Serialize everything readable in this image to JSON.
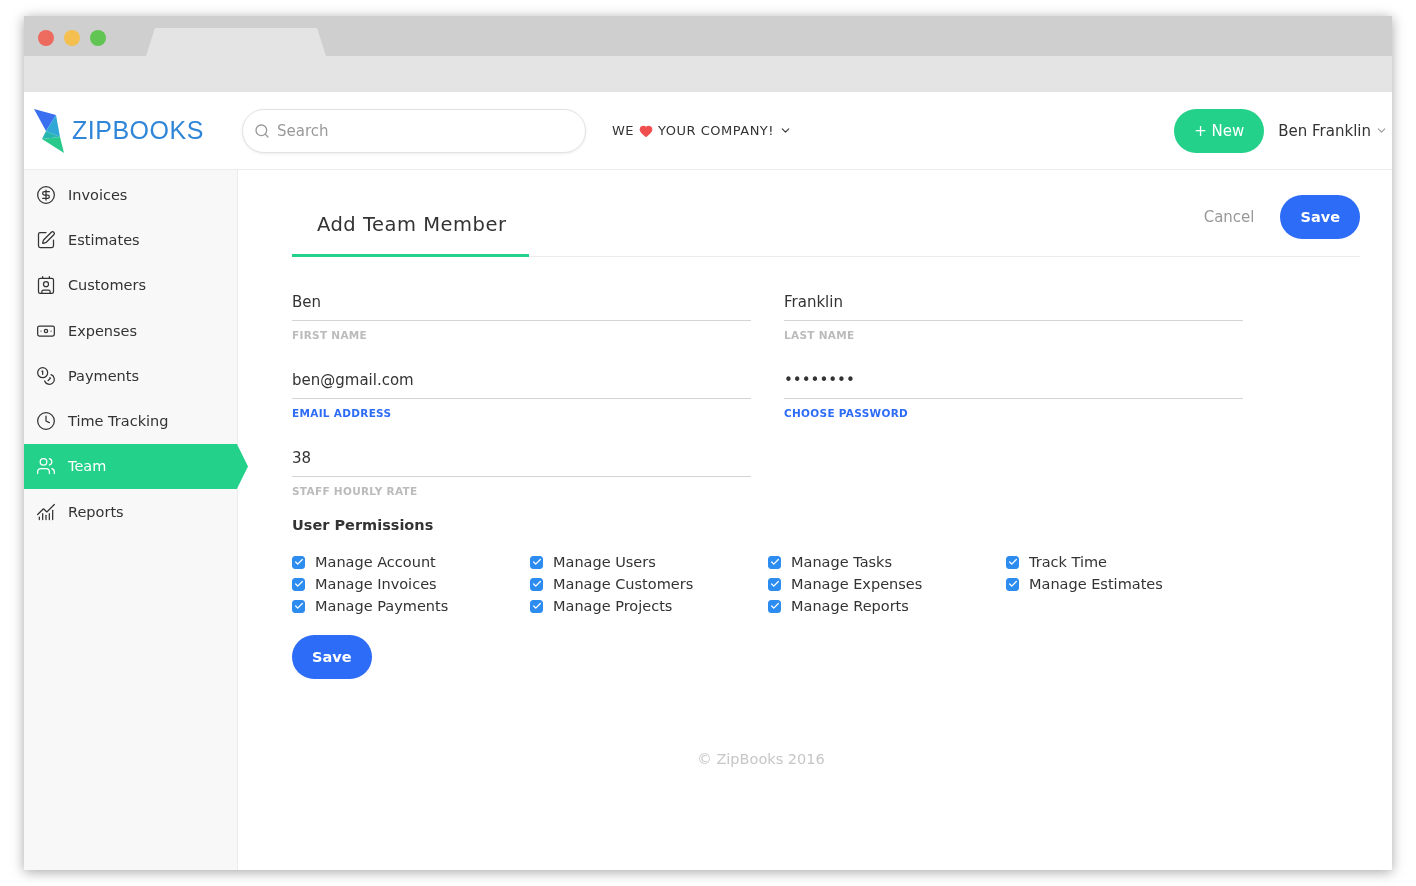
{
  "browser": {
    "tab": {
      "selected": true
    }
  },
  "header": {
    "logo": "ZIPBOOKS",
    "search": {
      "placeholder": "Search"
    },
    "company_menu": {
      "before": "WE",
      "after": "YOUR COMPANY!"
    },
    "new_button": "+ New",
    "user_menu": "Ben Franklin"
  },
  "sidebar": {
    "items": [
      {
        "label": "Invoices",
        "kind": "invoices",
        "selected": false
      },
      {
        "label": "Estimates",
        "kind": "estimates",
        "selected": false
      },
      {
        "label": "Customers",
        "kind": "customers",
        "selected": false
      },
      {
        "label": "Expenses",
        "kind": "expenses",
        "selected": false
      },
      {
        "label": "Payments",
        "kind": "payments",
        "selected": false
      },
      {
        "label": "Time Tracking",
        "kind": "time",
        "selected": false
      },
      {
        "label": "Team",
        "kind": "team",
        "selected": true
      },
      {
        "label": "Reports",
        "kind": "reports",
        "selected": false
      }
    ]
  },
  "page": {
    "title": "Add Team Member",
    "cancel": "Cancel",
    "save": "Save"
  },
  "form": {
    "rows": [
      [
        {
          "value": "Ben",
          "label": "FIRST NAME",
          "highlighted": false
        },
        {
          "value": "Franklin",
          "label": "LAST NAME",
          "highlighted": false
        }
      ],
      [
        {
          "value": "ben@gmail.com",
          "label": "EMAIL ADDRESS",
          "highlighted": true
        },
        {
          "value": "••••••••",
          "label": "CHOOSE PASSWORD",
          "highlighted": true
        }
      ],
      [
        {
          "value": "38",
          "label": "STAFF HOURLY RATE",
          "highlighted": false
        }
      ]
    ]
  },
  "permissions": {
    "title": "User Permissions",
    "items": [
      {
        "label": "Manage Account",
        "checked": true
      },
      {
        "label": "Manage Users",
        "checked": true
      },
      {
        "label": "Manage Tasks",
        "checked": true
      },
      {
        "label": "Track Time",
        "checked": true
      },
      {
        "label": "Manage Invoices",
        "checked": true
      },
      {
        "label": "Manage Customers",
        "checked": true
      },
      {
        "label": "Manage Expenses",
        "checked": true
      },
      {
        "label": "Manage Estimates",
        "checked": true
      },
      {
        "label": "Manage Payments",
        "checked": true
      },
      {
        "label": "Manage Projects",
        "checked": true
      },
      {
        "label": "Manage Reports",
        "checked": true
      }
    ]
  },
  "save_button": "Save",
  "footer": "© ZipBooks 2016"
}
